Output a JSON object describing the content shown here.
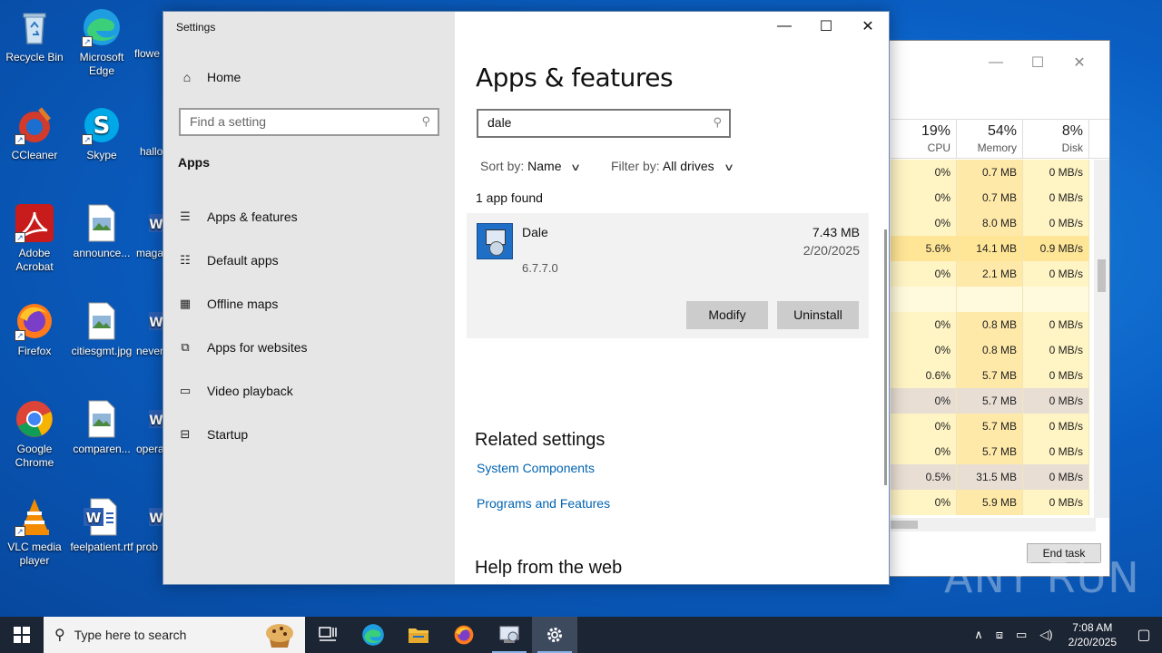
{
  "desktop": {
    "icons": [
      {
        "label": "Recycle Bin"
      },
      {
        "label": "Microsoft Edge"
      },
      {
        "label": "flowe"
      },
      {
        "label": "CCleaner"
      },
      {
        "label": "Skype"
      },
      {
        "label": "hallo"
      },
      {
        "label": "Adobe Acrobat"
      },
      {
        "label": "announce..."
      },
      {
        "label": "maga"
      },
      {
        "label": "Firefox"
      },
      {
        "label": "citiesgmt.jpg"
      },
      {
        "label": "never"
      },
      {
        "label": "Google Chrome"
      },
      {
        "label": "comparen..."
      },
      {
        "label": "opera"
      },
      {
        "label": "VLC media player"
      },
      {
        "label": "feelpatient.rtf"
      },
      {
        "label": "prob"
      }
    ]
  },
  "taskmgr": {
    "columns": [
      {
        "pct": "19%",
        "label": "CPU"
      },
      {
        "pct": "54%",
        "label": "Memory"
      },
      {
        "pct": "8%",
        "label": "Disk"
      }
    ],
    "rows": [
      [
        "0%",
        "0.7 MB",
        "0 MB/s"
      ],
      [
        "0%",
        "0.7 MB",
        "0 MB/s"
      ],
      [
        "0%",
        "8.0 MB",
        "0 MB/s"
      ],
      [
        "5.6%",
        "14.1 MB",
        "0.9 MB/s"
      ],
      [
        "0%",
        "2.1 MB",
        "0 MB/s"
      ],
      [
        "",
        "",
        ""
      ],
      [
        "0%",
        "0.8 MB",
        "0 MB/s"
      ],
      [
        "0%",
        "0.8 MB",
        "0 MB/s"
      ],
      [
        "0.6%",
        "5.7 MB",
        "0 MB/s"
      ],
      [
        "0%",
        "5.7 MB",
        "0 MB/s"
      ],
      [
        "0%",
        "5.7 MB",
        "0 MB/s"
      ],
      [
        "0%",
        "5.7 MB",
        "0 MB/s"
      ],
      [
        "0.5%",
        "31.5 MB",
        "0 MB/s"
      ],
      [
        "0%",
        "5.9 MB",
        "0 MB/s"
      ]
    ],
    "end_task": "End task"
  },
  "settings": {
    "window_title": "Settings",
    "home": "Home",
    "find_placeholder": "Find a setting",
    "section": "Apps",
    "nav": [
      {
        "label": "Apps & features",
        "icon": "list-icon"
      },
      {
        "label": "Default apps",
        "icon": "default-apps-icon"
      },
      {
        "label": "Offline maps",
        "icon": "map-icon"
      },
      {
        "label": "Apps for websites",
        "icon": "web-app-icon"
      },
      {
        "label": "Video playback",
        "icon": "video-icon"
      },
      {
        "label": "Startup",
        "icon": "startup-icon"
      }
    ],
    "page_title": "Apps & features",
    "search_value": "dale",
    "sort_label": "Sort by:",
    "sort_value": "Name",
    "filter_label": "Filter by:",
    "filter_value": "All drives",
    "count_text": "1 app found",
    "app": {
      "name": "Dale",
      "size": "7.43 MB",
      "date": "2/20/2025",
      "version": "6.7.7.0",
      "modify": "Modify",
      "uninstall": "Uninstall"
    },
    "related_title": "Related settings",
    "links": [
      "System Components",
      "Programs and Features"
    ],
    "help_title": "Help from the web"
  },
  "taskbar": {
    "search_placeholder": "Type here to search",
    "time": "7:08 AM",
    "date": "2/20/2025"
  },
  "watermark": "ANY RUN"
}
